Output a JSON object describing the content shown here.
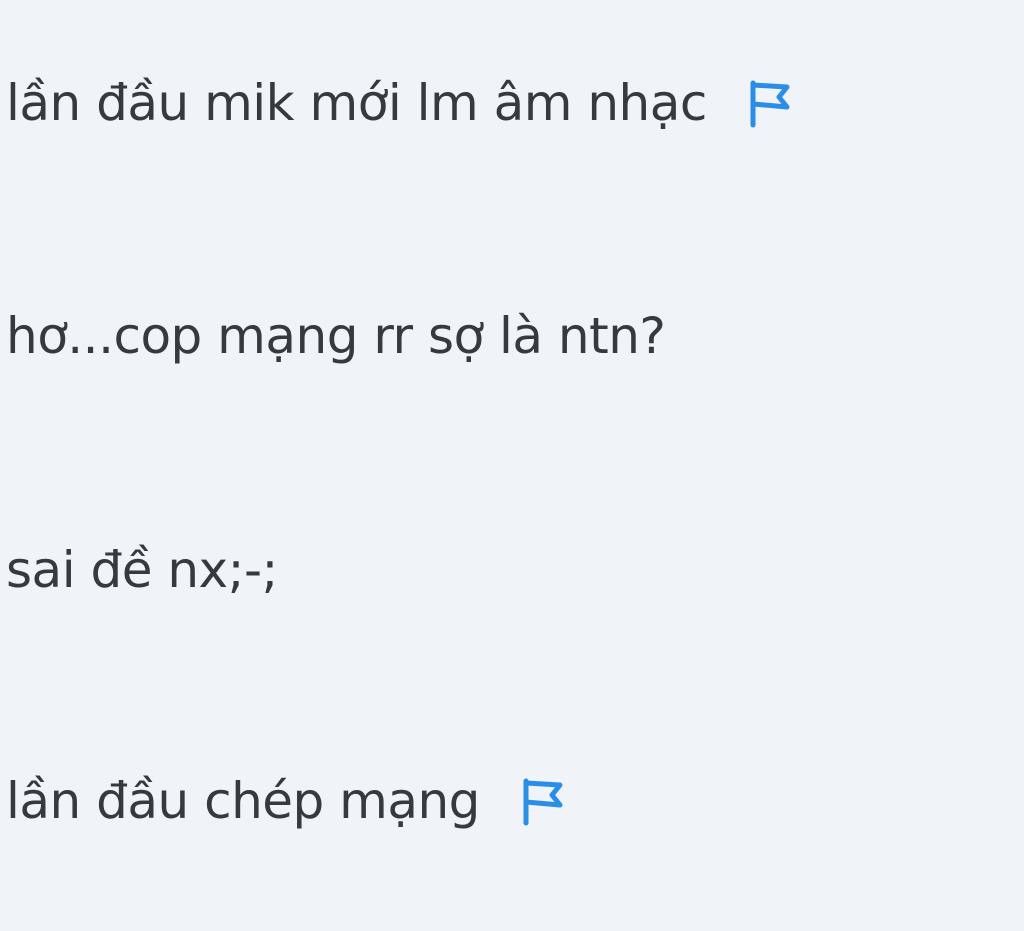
{
  "comments": [
    {
      "text": "lần đầu mik mới lm âm nhạc",
      "flag": true,
      "icon": "flag-icon"
    },
    {
      "text": "hơ...cop mạng rr sợ là ntn?",
      "flag": false
    },
    {
      "text": "sai đề nx;-;",
      "flag": false
    },
    {
      "text": "lần đầu chép mạng",
      "flag": true,
      "icon": "flag-icon"
    }
  ],
  "colors": {
    "background": "#f0f3f7",
    "text": "#343a40",
    "flag": "#2a8ee8"
  }
}
